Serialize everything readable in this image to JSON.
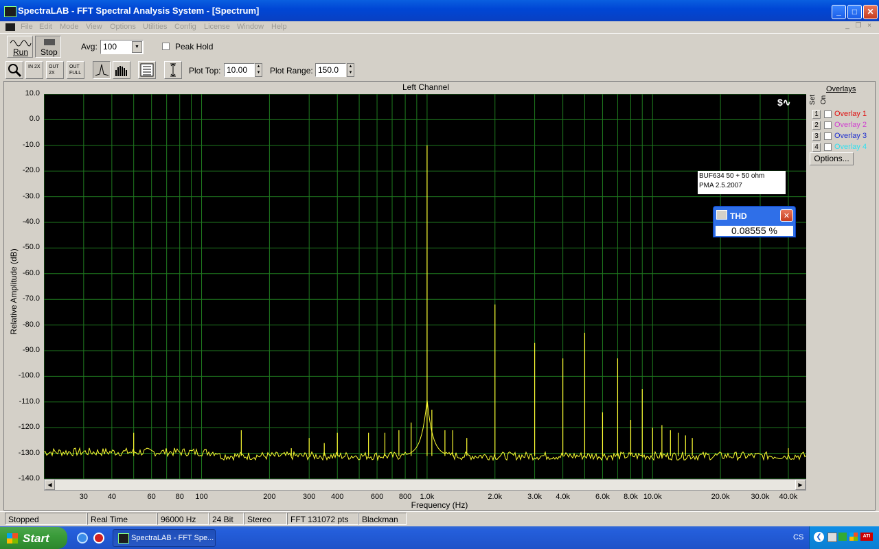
{
  "window": {
    "title": "SpectraLAB - FFT Spectral Analysis System - [Spectrum]"
  },
  "menu": [
    "File",
    "Edit",
    "Mode",
    "View",
    "Options",
    "Utilities",
    "Config",
    "License",
    "Window",
    "Help"
  ],
  "toolbar": {
    "run_label": "Run",
    "stop_label": "Stop",
    "avg_label": "Avg:",
    "avg_value": "100",
    "peak_hold_label": "Peak Hold",
    "plot_top_label": "Plot Top:",
    "plot_top_value": "10.00",
    "plot_range_label": "Plot Range:",
    "plot_range_value": "150.0",
    "zoom_in_text": "IN 2X",
    "zoom_out_text": "OUT 2X",
    "zoom_full_text": "OUT FULL"
  },
  "plot": {
    "channel_title": "Left Channel",
    "annotation_line1": "BUF634 50 + 50 ohm",
    "annotation_line2": "PMA 2.5.2007",
    "thd_title": "THD",
    "thd_value": "0.08555 %"
  },
  "overlays": {
    "heading": "Overlays",
    "set_label": "Set",
    "on_label": "On",
    "items": [
      {
        "num": "1",
        "label": "Overlay 1",
        "color": "#e01010"
      },
      {
        "num": "2",
        "label": "Overlay 2",
        "color": "#d040d0"
      },
      {
        "num": "3",
        "label": "Overlay 3",
        "color": "#2030d0"
      },
      {
        "num": "4",
        "label": "Overlay 4",
        "color": "#30e0f0"
      }
    ],
    "options_label": "Options..."
  },
  "status": [
    "Stopped",
    "Real Time",
    "96000 Hz",
    "24 Bit",
    "Stereo",
    "FFT 131072 pts",
    "Blackman"
  ],
  "taskbar": {
    "start_label": "Start",
    "task_label": "SpectraLAB - FFT Spe...",
    "tray_text": "CS"
  },
  "chart_data": {
    "type": "line",
    "title": "Left Channel",
    "xlabel": "Frequency (Hz)",
    "ylabel": "Relative Amplitude (dB)",
    "xscale": "log",
    "xlim": [
      20,
      48000
    ],
    "ylim": [
      -140,
      10
    ],
    "grid": true,
    "x_ticks": [
      "30",
      "40",
      "60",
      "80",
      "100",
      "200",
      "300",
      "400",
      "600",
      "800",
      "1.0k",
      "2.0k",
      "3.0k",
      "4.0k",
      "6.0k",
      "8.0k",
      "10.0k",
      "20.0k",
      "30.0k",
      "40.0k"
    ],
    "y_ticks": [
      "10.0",
      "0.0",
      "-10.0",
      "-20.0",
      "-30.0",
      "-40.0",
      "-50.0",
      "-60.0",
      "-70.0",
      "-80.0",
      "-90.0",
      "-100.0",
      "-110.0",
      "-120.0",
      "-130.0",
      "-140.0"
    ],
    "noise_floor": -131,
    "series": [
      {
        "color": "#ffff33",
        "peaks": [
          {
            "x": 50,
            "y": -122
          },
          {
            "x": 150,
            "y": -121
          },
          {
            "x": 250,
            "y": -128
          },
          {
            "x": 300,
            "y": -124
          },
          {
            "x": 350,
            "y": -126
          },
          {
            "x": 400,
            "y": -122
          },
          {
            "x": 550,
            "y": -122
          },
          {
            "x": 650,
            "y": -122
          },
          {
            "x": 750,
            "y": -121
          },
          {
            "x": 850,
            "y": -118
          },
          {
            "x": 1000,
            "y": -10
          },
          {
            "x": 1050,
            "y": -113
          },
          {
            "x": 1200,
            "y": -121
          },
          {
            "x": 1300,
            "y": -121
          },
          {
            "x": 1500,
            "y": -124
          },
          {
            "x": 2000,
            "y": -72
          },
          {
            "x": 3000,
            "y": -87
          },
          {
            "x": 4000,
            "y": -93
          },
          {
            "x": 5000,
            "y": -83
          },
          {
            "x": 6000,
            "y": -114
          },
          {
            "x": 7000,
            "y": -93
          },
          {
            "x": 8000,
            "y": -117
          },
          {
            "x": 9000,
            "y": -105
          },
          {
            "x": 10000,
            "y": -120
          },
          {
            "x": 11000,
            "y": -119
          },
          {
            "x": 12000,
            "y": -121
          },
          {
            "x": 13000,
            "y": -122
          },
          {
            "x": 14000,
            "y": -123
          },
          {
            "x": 15000,
            "y": -124
          },
          {
            "x": 40000,
            "y": -128
          }
        ]
      }
    ]
  }
}
